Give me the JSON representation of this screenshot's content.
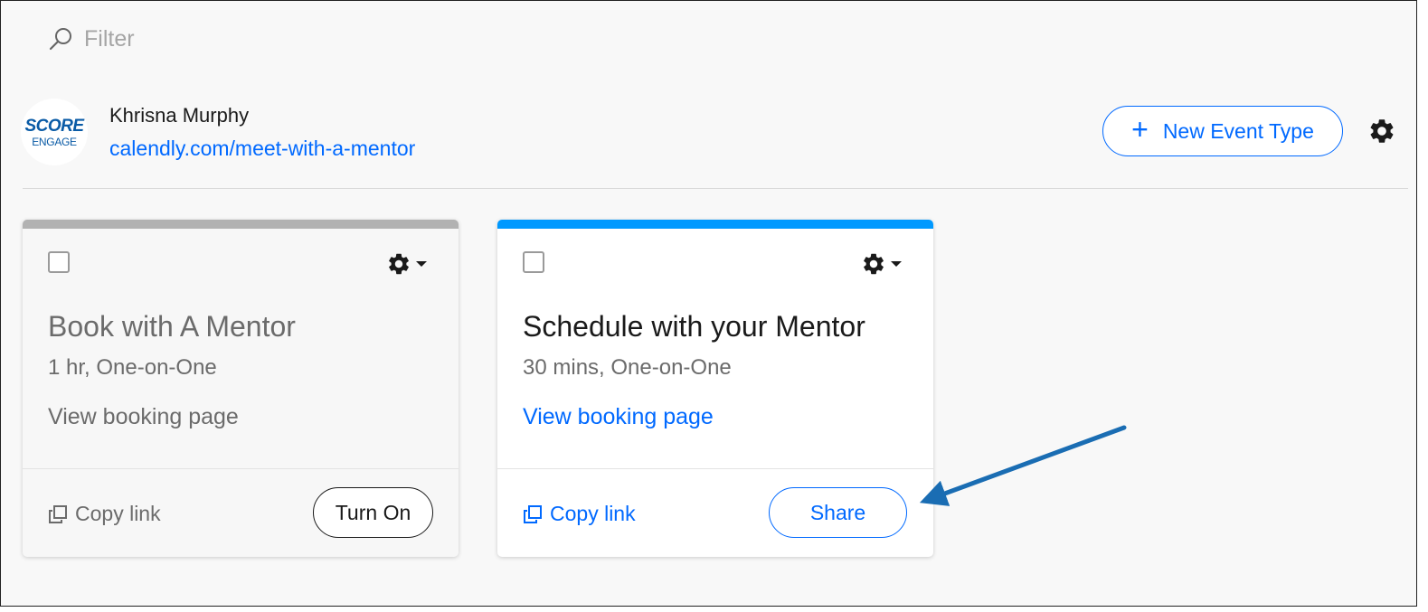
{
  "filter": {
    "placeholder": "Filter",
    "icon": "search-icon"
  },
  "profile": {
    "logo_line1": "SCORE",
    "logo_line2": "ENGAGE",
    "name": "Khrisna Murphy",
    "link": "calendly.com/meet-with-a-mentor"
  },
  "header": {
    "new_event_label": "New Event Type",
    "new_event_icon": "plus-icon",
    "settings_icon": "gear-icon"
  },
  "colors": {
    "accent": "#0069ff",
    "active_bar": "#0099ff",
    "inactive_bar": "#b2b2b2",
    "arrow": "#1a6db3"
  },
  "event_types": [
    {
      "title": "Book with A Mentor",
      "duration": "1 hr, One-on-One",
      "view_label": "View booking page",
      "copy_label": "Copy link",
      "action_label": "Turn On",
      "active": false
    },
    {
      "title": "Schedule with your Mentor",
      "duration": "30 mins, One-on-One",
      "view_label": "View booking page",
      "copy_label": "Copy link",
      "action_label": "Share",
      "active": true
    }
  ]
}
